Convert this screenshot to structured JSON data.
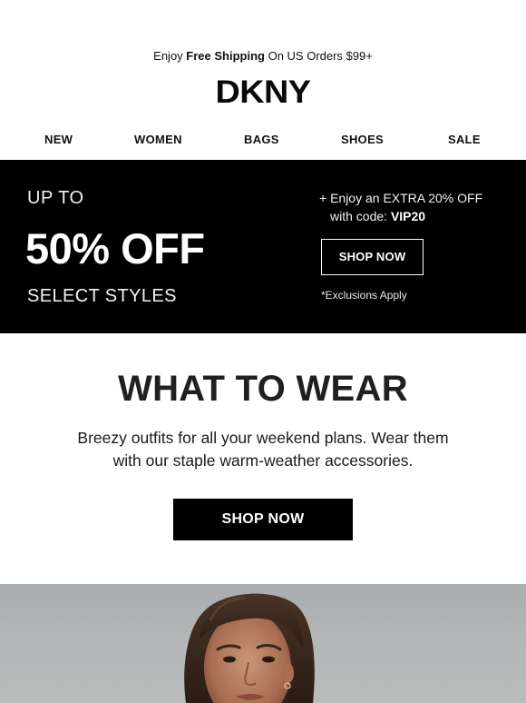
{
  "announcement": {
    "prefix": "Enjoy ",
    "highlight": "Free Shipping",
    "suffix": " On US Orders $99+"
  },
  "brand": {
    "logo_text": "DKNY"
  },
  "nav": {
    "items": [
      {
        "label": "NEW"
      },
      {
        "label": "WOMEN"
      },
      {
        "label": "BAGS"
      },
      {
        "label": "SHOES"
      },
      {
        "label": "SALE"
      }
    ]
  },
  "promo": {
    "up_to": "UP TO",
    "headline": "50% OFF",
    "subline": "SELECT STYLES",
    "extra_offer": "+ Enjoy an EXTRA 20% OFF",
    "code_prefix": "with code: ",
    "code": "VIP20",
    "button_label": "SHOP NOW",
    "disclaimer": "*Exclusions Apply"
  },
  "feature": {
    "title": "WHAT TO WEAR",
    "description": "Breezy outfits for all your weekend plans. Wear them with our staple warm-weather accessories.",
    "button_label": "SHOP NOW"
  },
  "colors": {
    "background": "#ffffff",
    "banner": "#000000",
    "text": "#111111",
    "hero_backdrop": "#b4b7b8"
  }
}
